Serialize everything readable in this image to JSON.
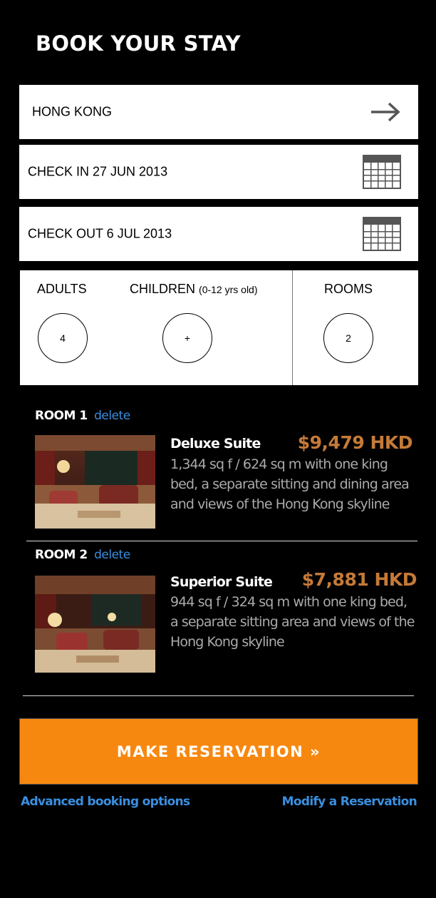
{
  "header": {
    "title": "BOOK YOUR STAY"
  },
  "search": {
    "destination": "HONG KONG",
    "check_in": "CHECK IN 27 JUN 2013",
    "check_out": "CHECK OUT 6 JUL 2013"
  },
  "guests": {
    "adults_label": "ADULTS",
    "adults_value": "4",
    "children_label": "CHILDREN",
    "children_note": "(0-12 yrs old)",
    "children_value": "+",
    "rooms_label": "ROOMS",
    "rooms_value": "2"
  },
  "rooms": [
    {
      "header": "ROOM 1",
      "delete_label": "delete",
      "name": "Deluxe Suite",
      "price": "$9,479 HKD",
      "description": "1,344 sq f / 624 sq m with one king bed, a separate sitting  and dining area and views of the Hong Kong skyline"
    },
    {
      "header": "ROOM 2",
      "delete_label": "delete",
      "name": "Superior Suite",
      "price": "$7,881 HKD",
      "description": "944 sq f / 324 sq m with one king bed, a separate sitting area and views of the Hong Kong skyline"
    }
  ],
  "actions": {
    "reserve_label": "MAKE RESERVATION »",
    "advanced_link": "Advanced booking options",
    "modify_link": "Modify a Reservation"
  },
  "colors": {
    "background": "#000000",
    "accent": "#f7880f",
    "price": "#c57a38",
    "link": "#3a8fe0"
  }
}
